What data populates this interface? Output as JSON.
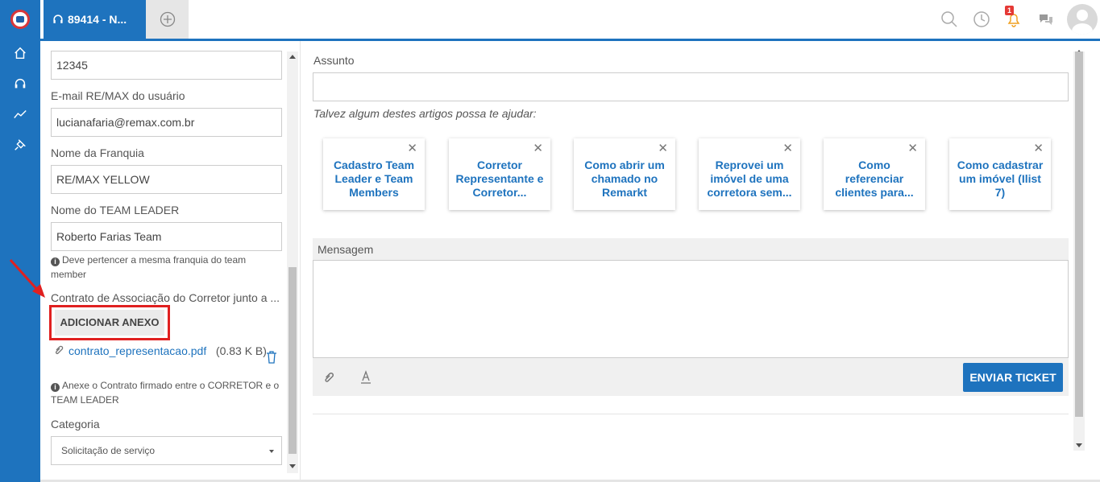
{
  "tab": {
    "label": "89414 - N..."
  },
  "notifications": {
    "badge": "1"
  },
  "form": {
    "top_value": "12345",
    "email_label": "E-mail RE/MAX do usuário",
    "email_value": "lucianafaria@remax.com.br",
    "franchise_label": "Nome da Franquia",
    "franchise_value": "RE/MAX YELLOW",
    "teamleader_label": "Nome do TEAM LEADER",
    "teamleader_value": "Roberto Farias Team",
    "teamleader_hint": "Deve pertencer a mesma franquia do team member",
    "contract_label": "Contrato de Associação do Corretor junto a ...",
    "add_attachment": "ADICIONAR ANEXO",
    "attachment_name": "contrato_representacao.pdf",
    "attachment_size": "(0.83 K B)",
    "contract_hint": "Anexe o Contrato firmado entre o CORRETOR e o TEAM LEADER",
    "category_label": "Categoria",
    "category_value": "Solicitação de serviço"
  },
  "main": {
    "subject_label": "Assunto",
    "help_text": "Talvez algum destes artigos possa te ajudar:",
    "articles": [
      "Cadastro Team Leader e Team Members",
      "Corretor Representante e Corretor...",
      "Como abrir um chamado no Remarkt",
      "Reprovei um imóvel de uma corretora sem...",
      "Como referenciar clientes para...",
      "Como cadastrar um imóvel (Ilist 7)"
    ],
    "message_label": "Mensagem",
    "send_button": "ENVIAR TICKET"
  },
  "colors": {
    "brand_blue": "#1e73be",
    "highlight_red": "#e02020"
  }
}
